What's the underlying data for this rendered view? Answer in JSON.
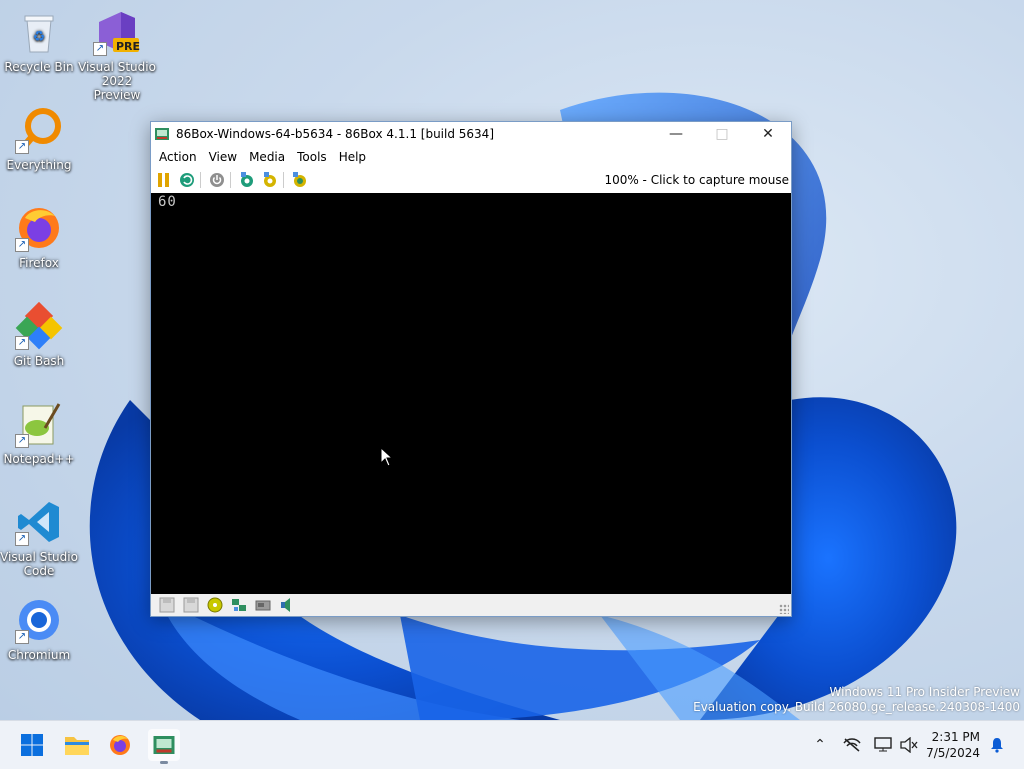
{
  "desktop": {
    "icons": [
      {
        "label": "Recycle Bin"
      },
      {
        "label": "Visual Studio 2022 Preview",
        "badge": "PRE"
      },
      {
        "label": "Everything"
      },
      {
        "label": "Firefox"
      },
      {
        "label": "Git Bash"
      },
      {
        "label": "Notepad++"
      },
      {
        "label": "Visual Studio Code"
      },
      {
        "label": "Chromium"
      }
    ],
    "watermark_line1": "Windows 11 Pro Insider Preview",
    "watermark_line2": "Evaluation copy. Build 26080.ge_release.240308-1400"
  },
  "window": {
    "title": "86Box-Windows-64-b5634 - 86Box 4.1.1 [build 5634]",
    "menu": [
      "Action",
      "View",
      "Media",
      "Tools",
      "Help"
    ],
    "toolbar_status": "100% - Click to capture mouse",
    "screen_text": "60",
    "toolbar_icons": [
      "pause-icon",
      "reset-icon",
      "power-icon",
      "settings-icon",
      "hard-reset-icon",
      "screenshot-icon"
    ],
    "statusbar_icons": [
      "floppy-a-icon",
      "floppy-b-icon",
      "cdrom-icon",
      "network-icon",
      "hdd-icon",
      "sound-icon"
    ]
  },
  "taskbar": {
    "time": "2:31 PM",
    "date": "7/5/2024",
    "apps": [
      "start-icon",
      "file-explorer-icon",
      "firefox-icon",
      "86box-icon"
    ]
  },
  "colors": {
    "accent": "#0b5cd5",
    "window_border": "#7a9cc6",
    "screen_bg": "#000000"
  }
}
